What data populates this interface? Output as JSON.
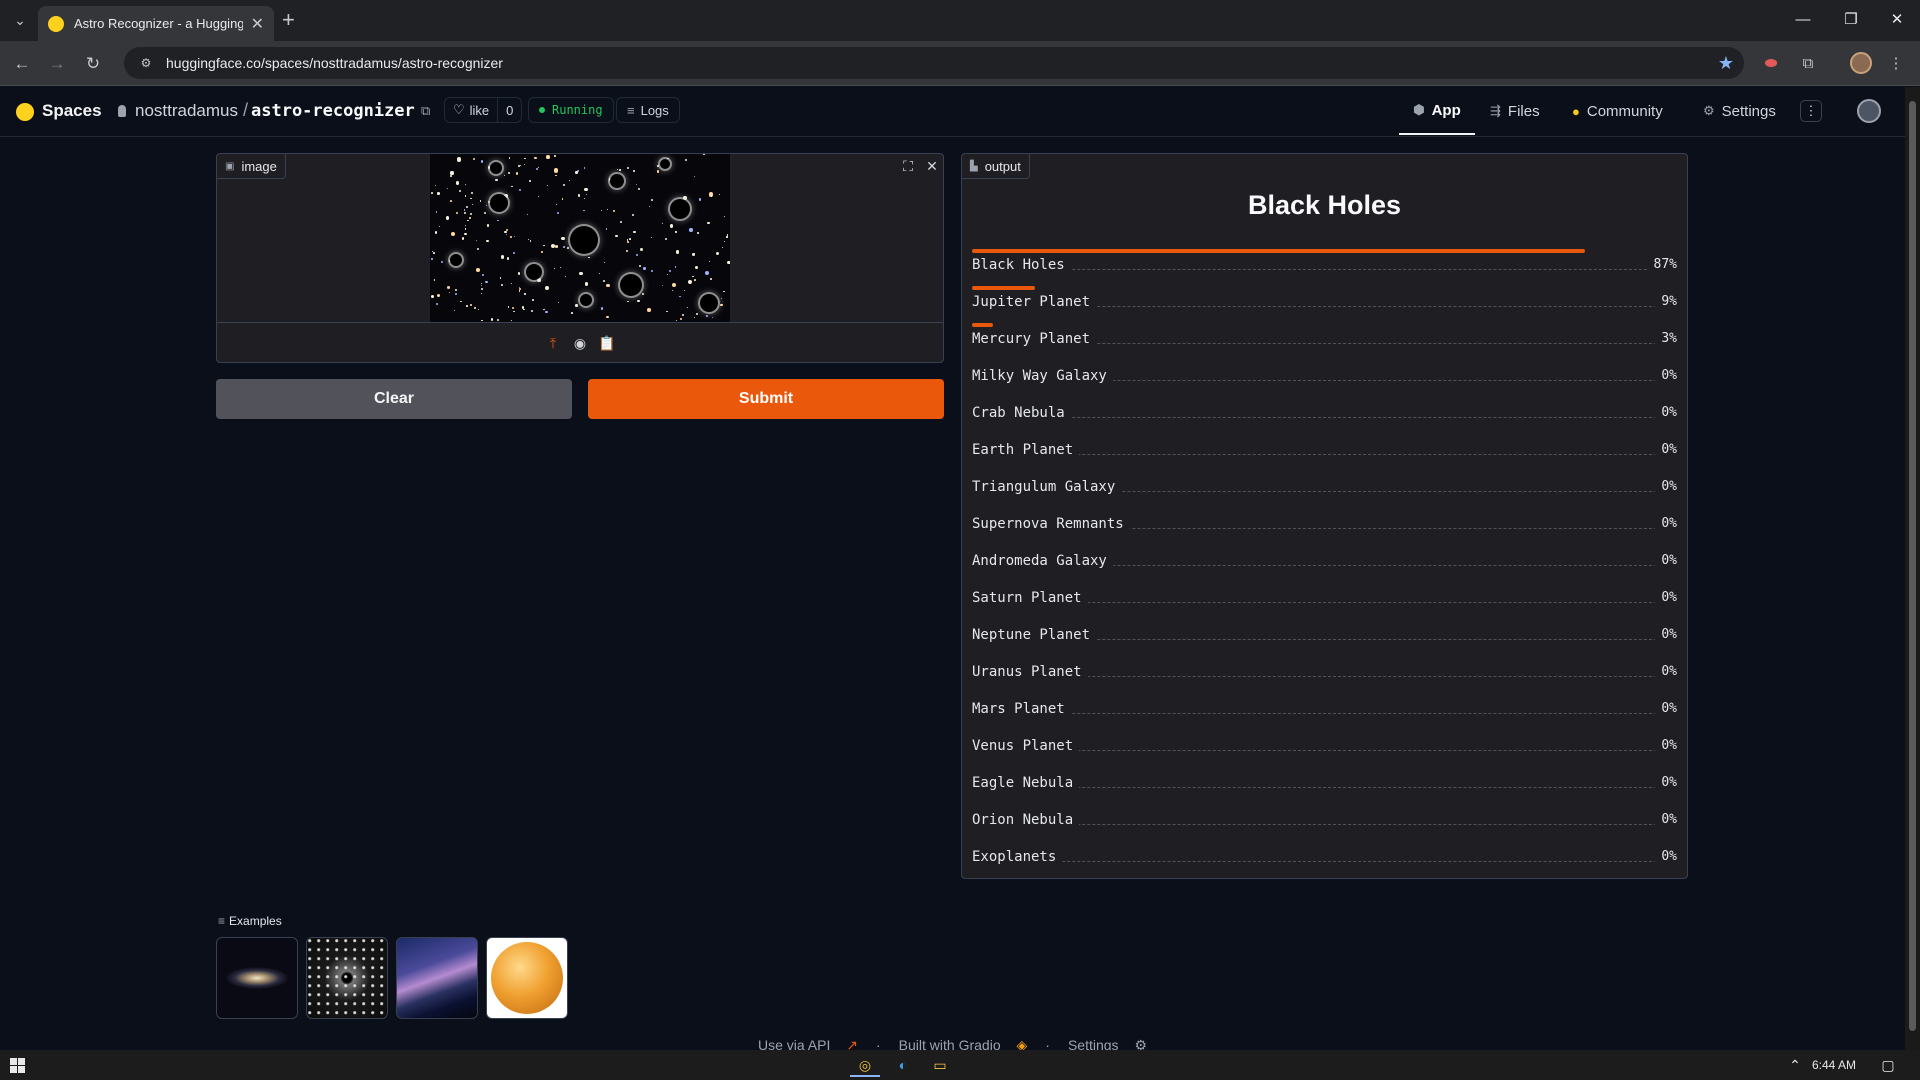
{
  "browser": {
    "tab_title": "Astro Recognizer - a Hugging F",
    "url": "huggingface.co/spaces/nosttradamus/astro-recognizer"
  },
  "hf": {
    "spaces_label": "Spaces",
    "owner": "nosttradamus",
    "slash": "/",
    "repo": "astro-recognizer",
    "like_label": "like",
    "like_count": "0",
    "status": "Running",
    "logs_label": "Logs",
    "nav": [
      {
        "label": "App",
        "icon": "app-icon"
      },
      {
        "label": "Files",
        "icon": "files-icon"
      },
      {
        "label": "Community",
        "icon": "community-icon"
      },
      {
        "label": "Settings",
        "icon": "settings-icon"
      }
    ]
  },
  "input": {
    "label": "image"
  },
  "buttons": {
    "clear": "Clear",
    "submit": "Submit"
  },
  "output": {
    "label": "output",
    "top_label": "Black Holes",
    "accent": "#ea580c",
    "results": [
      {
        "label": "Black Holes",
        "pct": "87%",
        "value": 0.87
      },
      {
        "label": "Jupiter Planet",
        "pct": "9%",
        "value": 0.09
      },
      {
        "label": "Mercury Planet",
        "pct": "3%",
        "value": 0.03
      },
      {
        "label": "Milky Way Galaxy",
        "pct": "0%",
        "value": 0.0
      },
      {
        "label": "Crab Nebula",
        "pct": "0%",
        "value": 0.0
      },
      {
        "label": "Earth Planet",
        "pct": "0%",
        "value": 0.0
      },
      {
        "label": "Triangulum Galaxy",
        "pct": "0%",
        "value": 0.0
      },
      {
        "label": "Supernova Remnants",
        "pct": "0%",
        "value": 0.0
      },
      {
        "label": "Andromeda Galaxy",
        "pct": "0%",
        "value": 0.0
      },
      {
        "label": "Saturn Planet",
        "pct": "0%",
        "value": 0.0
      },
      {
        "label": "Neptune Planet",
        "pct": "0%",
        "value": 0.0
      },
      {
        "label": "Uranus Planet",
        "pct": "0%",
        "value": 0.0
      },
      {
        "label": "Mars Planet",
        "pct": "0%",
        "value": 0.0
      },
      {
        "label": "Venus Planet",
        "pct": "0%",
        "value": 0.0
      },
      {
        "label": "Eagle Nebula",
        "pct": "0%",
        "value": 0.0
      },
      {
        "label": "Orion Nebula",
        "pct": "0%",
        "value": 0.0
      },
      {
        "label": "Exoplanets",
        "pct": "0%",
        "value": 0.0
      }
    ]
  },
  "examples": {
    "label": "Examples",
    "items": [
      {
        "name": "example-galaxy-thumbnail"
      },
      {
        "name": "example-blackholes-thumbnail"
      },
      {
        "name": "example-milkyway-thumbnail"
      },
      {
        "name": "example-planet-thumbnail"
      }
    ]
  },
  "footer": {
    "api": "Use via API",
    "built": "Built with Gradio",
    "settings": "Settings",
    "sep": "·"
  },
  "taskbar": {
    "time": "6:44 AM"
  }
}
